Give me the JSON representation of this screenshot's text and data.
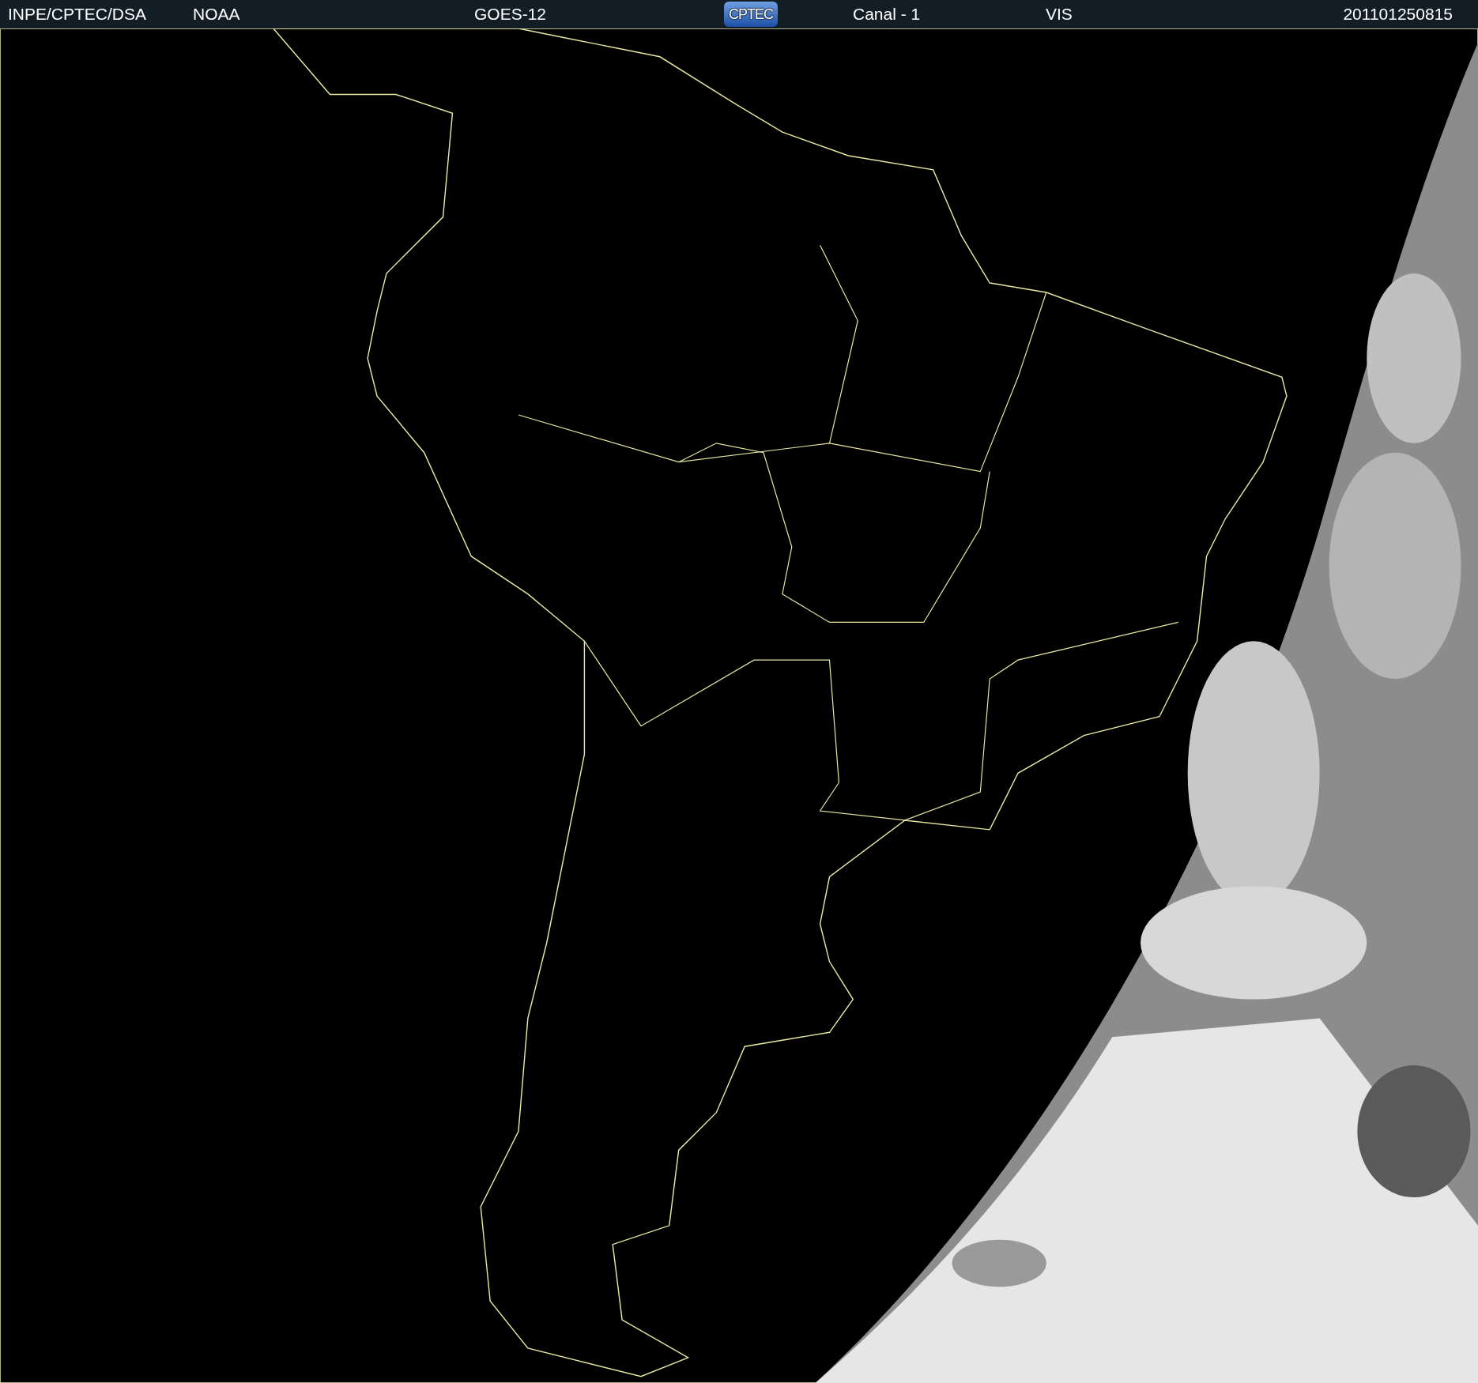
{
  "header": {
    "items": [
      {
        "kind": "text",
        "text": "INPE/CPTEC/DSA"
      },
      {
        "kind": "text",
        "text": "NOAA"
      },
      {
        "kind": "text",
        "text": "GOES-12"
      },
      {
        "kind": "logo",
        "text": "CPTEC"
      },
      {
        "kind": "text",
        "text": "Canal - 1"
      },
      {
        "kind": "text",
        "text": "VIS"
      },
      {
        "kind": "text",
        "text": "201101250815"
      }
    ]
  }
}
